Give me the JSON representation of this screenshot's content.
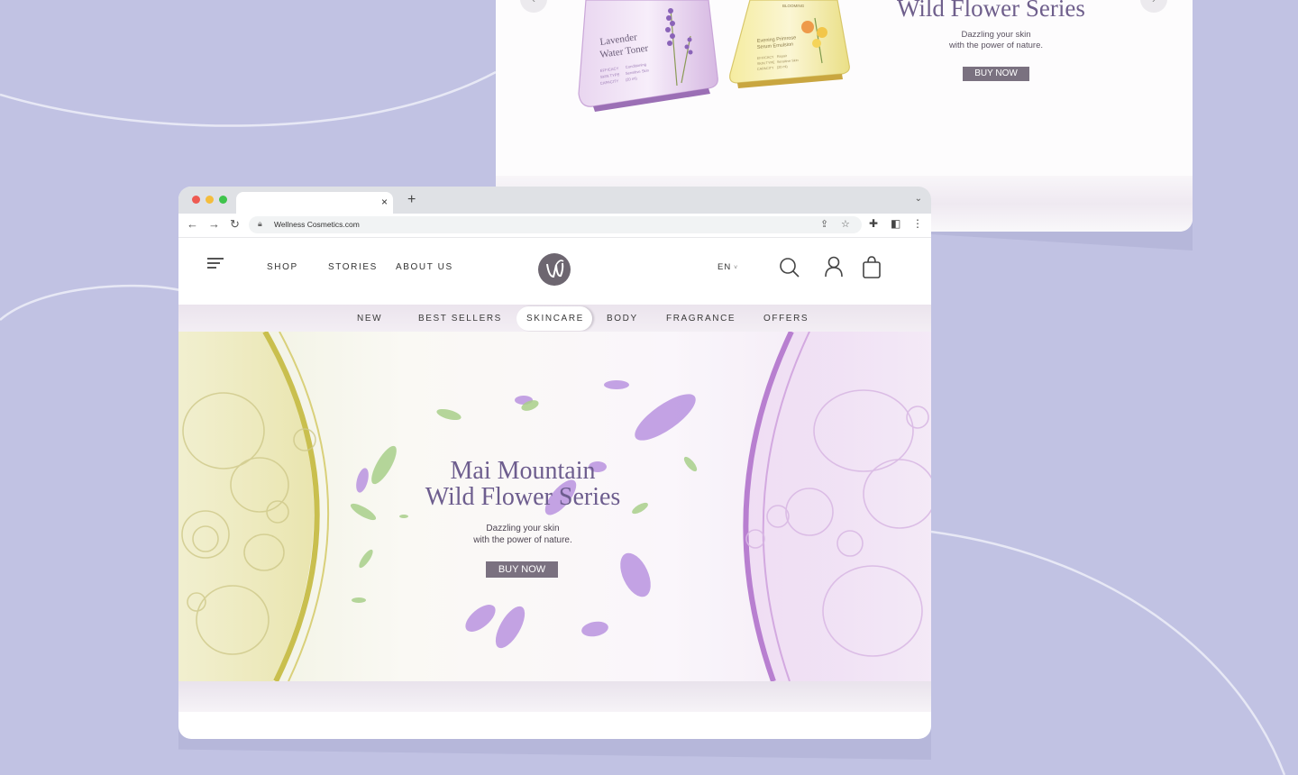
{
  "back_preview": {
    "title": "Wild Flower Series",
    "subtitle_line1": "Dazzling your skin",
    "subtitle_line2": "with the power of nature.",
    "cta": "BUY NOW",
    "product1": {
      "name_line1": "Lavender",
      "name_line2": "Water Toner",
      "spec_labels": [
        "EFFICACY",
        "SKIN TYPE",
        "CAPACITY"
      ],
      "spec_values": [
        "Conditioning",
        "Sensitive Skin",
        "(20 ml)"
      ]
    },
    "product2": {
      "brand": "BLOOMING",
      "name_line1": "Evening Primrose",
      "name_line2": "Serum Emulsion",
      "spec_labels": [
        "EFFICACY",
        "SKIN TYPE",
        "CAPACITY"
      ],
      "spec_values": [
        "Repair",
        "Sensitive Skin",
        "(20 ml)"
      ]
    }
  },
  "browser": {
    "url": "Wellness Cosmetics.com",
    "tab_close": "×",
    "new_tab": "+"
  },
  "header": {
    "nav": [
      "SHOP",
      "STORIES",
      "ABOUT US"
    ],
    "language": "EN"
  },
  "categories": [
    "NEW",
    "BEST SELLERS",
    "SKINCARE",
    "BODY",
    "FRAGRANCE",
    "OFFERS"
  ],
  "active_category": "SKINCARE",
  "hero": {
    "title_line1": "Mai Mountain",
    "title_line2": "Wild Flower Series",
    "subtitle_line1": "Dazzling your skin",
    "subtitle_line2": "with the power of nature.",
    "cta": "BUY NOW"
  },
  "colors": {
    "background": "#c1c2e3",
    "title_purple": "#6d5d8e",
    "button": "#7a7180",
    "logo": "#6d6670"
  }
}
